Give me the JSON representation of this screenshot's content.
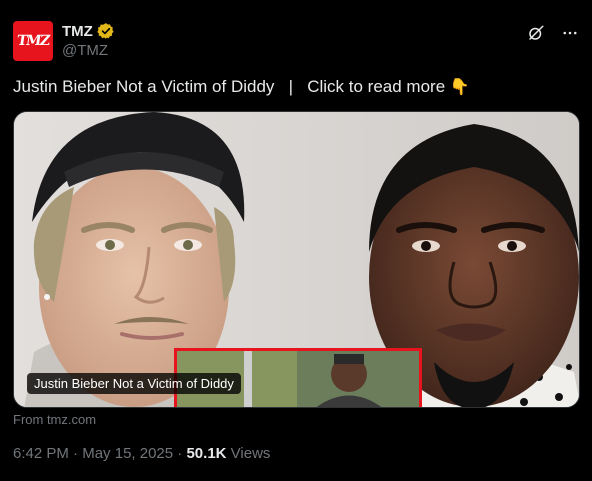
{
  "account": {
    "avatar_text": "TMZ",
    "display_name": "TMZ",
    "handle": "@TMZ",
    "verified_badge_color": "#e2b719"
  },
  "tweet": {
    "headline": "Justin Bieber Not a Victim of Diddy",
    "separator": "|",
    "cta": "Click to read more",
    "emoji": "👇"
  },
  "media": {
    "caption": "Justin Bieber Not a Victim of Diddy"
  },
  "link_source": "From tmz.com",
  "meta": {
    "time": "6:42 PM",
    "dot1": "·",
    "date": "May 15, 2025",
    "dot2": "·",
    "views_count": "50.1K",
    "views_label": "Views"
  },
  "icons": {
    "grok": "grok-icon",
    "more": "more-icon",
    "verified": "verified-badge-icon"
  },
  "colors": {
    "background": "#000000",
    "text_primary": "#e7e9ea",
    "text_secondary": "#71767b",
    "brand_red": "#e8141d"
  }
}
